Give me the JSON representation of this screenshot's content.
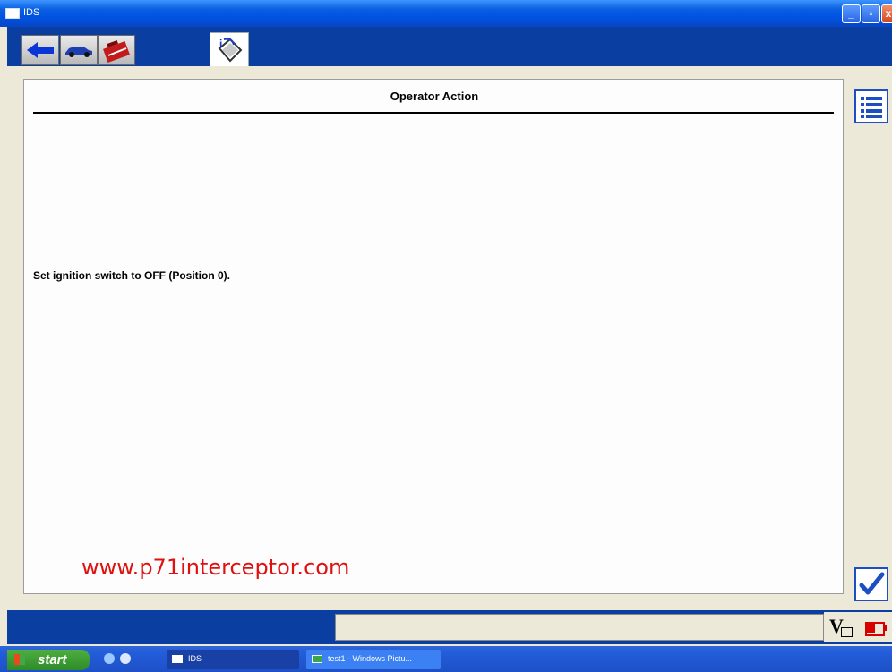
{
  "window": {
    "title": "IDS",
    "minimize": "_",
    "maximize": "▫",
    "close": "x"
  },
  "toolbar": {
    "icons": [
      "back-arrow-icon",
      "vehicle-icon",
      "toolbox-icon",
      "info-icon"
    ]
  },
  "panel": {
    "title": "Operator Action",
    "instruction": "Set ignition switch to OFF (Position 0)."
  },
  "watermark": "www.p71interceptor.com",
  "side_buttons": {
    "list_icon": "list-icon",
    "confirm_icon": "checkmark-icon"
  },
  "statusbar": {
    "voltage_label": "V",
    "battery_icon": "battery-icon"
  },
  "taskbar": {
    "start_label": "start",
    "tasks": [
      {
        "label": "IDS"
      },
      {
        "label": "test1 - Windows Pictu..."
      }
    ]
  },
  "colors": {
    "titlebar": "#0054e3",
    "toolbar": "#0a3ea0",
    "watermark": "#e01010",
    "battery": "#d60000"
  }
}
